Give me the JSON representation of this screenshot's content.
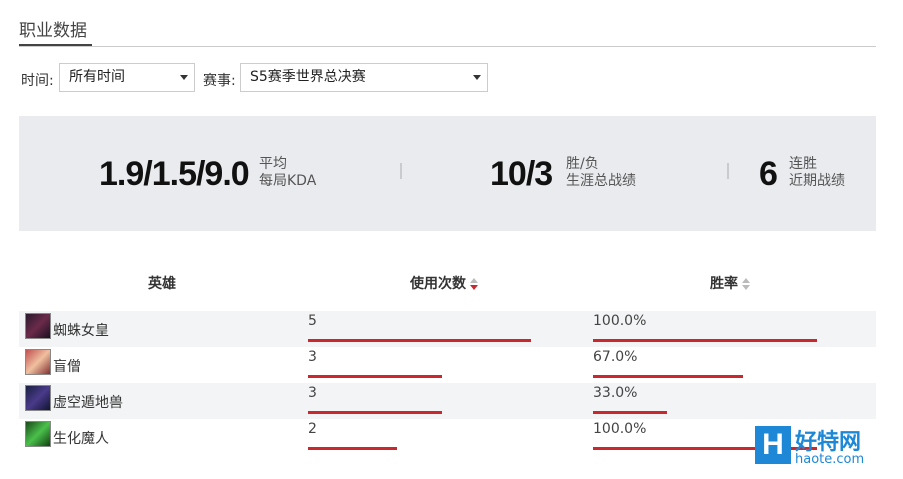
{
  "header": {
    "title": "职业数据"
  },
  "filters": {
    "time_label": "时间:",
    "time_value": "所有时间",
    "event_label": "赛事:",
    "event_value": "S5赛季世界总决赛"
  },
  "summary": {
    "kda": {
      "value": "1.9/1.5/9.0",
      "line1": "平均",
      "line2": "每局KDA"
    },
    "record": {
      "value": "10/3",
      "line1": "胜/负",
      "line2": "生涯总战绩"
    },
    "streak": {
      "value": "6",
      "line1": "连胜",
      "line2": "近期战绩"
    }
  },
  "table": {
    "headers": {
      "hero": "英雄",
      "uses": "使用次数",
      "winrate": "胜率"
    },
    "sort": {
      "column": "uses",
      "direction": "desc"
    },
    "rows": [
      {
        "hero": "蜘蛛女皇",
        "icon": "elise-portrait-icon",
        "uses": "5",
        "winrate": "100.0%",
        "uses_frac": 1.0,
        "win_frac": 1.0
      },
      {
        "hero": "盲僧",
        "icon": "lee-sin-portrait-icon",
        "uses": "3",
        "winrate": "67.0%",
        "uses_frac": 0.6,
        "win_frac": 0.67
      },
      {
        "hero": "虚空遁地兽",
        "icon": "reksai-portrait-icon",
        "uses": "3",
        "winrate": "33.0%",
        "uses_frac": 0.6,
        "win_frac": 0.33
      },
      {
        "hero": "生化魔人",
        "icon": "zac-portrait-icon",
        "uses": "2",
        "winrate": "100.0%",
        "uses_frac": 0.4,
        "win_frac": 1.0
      }
    ]
  },
  "colors": {
    "accent": "#c8282e",
    "panel": "#e9ebee",
    "watermark": "#1e88d6"
  },
  "watermark": {
    "logo_letter": "H",
    "name": "好特网",
    "url": "haote.com"
  }
}
